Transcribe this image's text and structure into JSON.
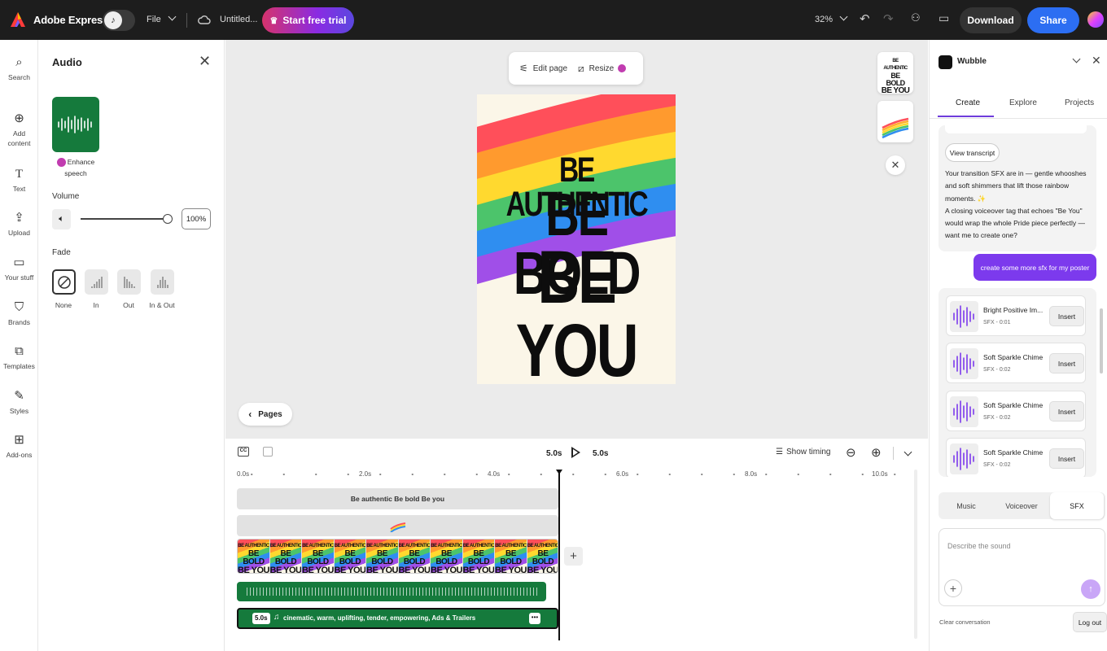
{
  "topbar": {
    "brand": "Adobe Express",
    "file_label": "File",
    "doc_title": "Untitled...",
    "trial_label": "Start free trial",
    "zoom": "32%",
    "download_label": "Download",
    "share_label": "Share"
  },
  "rail": {
    "items": [
      {
        "label": "Search",
        "icon": "search-icon"
      },
      {
        "label": "Add content",
        "icon": "plus-circle-icon"
      },
      {
        "label": "Text",
        "icon": "text-icon"
      },
      {
        "label": "Upload",
        "icon": "upload-icon"
      },
      {
        "label": "Your stuff",
        "icon": "folder-icon"
      },
      {
        "label": "Brands",
        "icon": "brand-icon"
      },
      {
        "label": "Templates",
        "icon": "templates-icon"
      },
      {
        "label": "Styles",
        "icon": "styles-icon"
      },
      {
        "label": "Add-ons",
        "icon": "addons-icon"
      }
    ]
  },
  "audio_panel": {
    "title": "Audio",
    "enhance_label": "Enhance speech",
    "volume_label": "Volume",
    "volume_value": "100%",
    "volume_level": 1.0,
    "fade_label": "Fade",
    "fade_options": [
      "None",
      "In",
      "Out",
      "In & Out"
    ],
    "fade_selected": "None"
  },
  "canvas": {
    "edit_page_label": "Edit page",
    "resize_label": "Resize",
    "poster_lines": [
      "BE AUTHENTIC",
      "BE BOLD",
      "BE YOU"
    ],
    "pages_label": "Pages"
  },
  "timeline": {
    "current_time": "5.0s",
    "total_time": "5.0s",
    "show_timing_label": "Show timing",
    "ruler_labels": [
      "0.0s",
      "2.0s",
      "4.0s",
      "6.0s",
      "8.0s",
      "10.0s"
    ],
    "text_track_label": "Be authentic Be bold Be you",
    "music_badge": "5.0s",
    "music_label": "cinematic, warm, uplifting, tender, empowering, Ads & Trailers"
  },
  "right_panel": {
    "title": "Wubble",
    "tabs": [
      "Create",
      "Explore",
      "Projects"
    ],
    "active_tab": "Create",
    "view_transcript": "View transcript",
    "assistant_message": "Your transition SFX are in — gentle whooshes and soft shimmers that lift those rainbow moments. ✨",
    "assistant_message_2": "A closing voiceover tag that echoes \"Be You\" would wrap the whole Pride piece perfectly — want me to create one?",
    "user_message": "create some more sfx for my poster",
    "sfx_items": [
      {
        "name": "Bright Positive Im...",
        "meta": "SFX - 0:01"
      },
      {
        "name": "Soft Sparkle Chime",
        "meta": "SFX - 0:02"
      },
      {
        "name": "Soft Sparkle Chime",
        "meta": "SFX - 0:02"
      },
      {
        "name": "Soft Sparkle Chime",
        "meta": "SFX - 0:02"
      }
    ],
    "insert_label": "Insert",
    "segments": [
      "Music",
      "Voiceover",
      "SFX"
    ],
    "active_segment": "SFX",
    "input_placeholder": "Describe the sound",
    "clear_label": "Clear conversation",
    "logout_label": "Log out"
  },
  "colors": {
    "accent_purple": "#7c3aed",
    "share_blue": "#2c6ef2",
    "audio_green": "#157a3c",
    "topbar_bg": "#1d1d1d"
  }
}
